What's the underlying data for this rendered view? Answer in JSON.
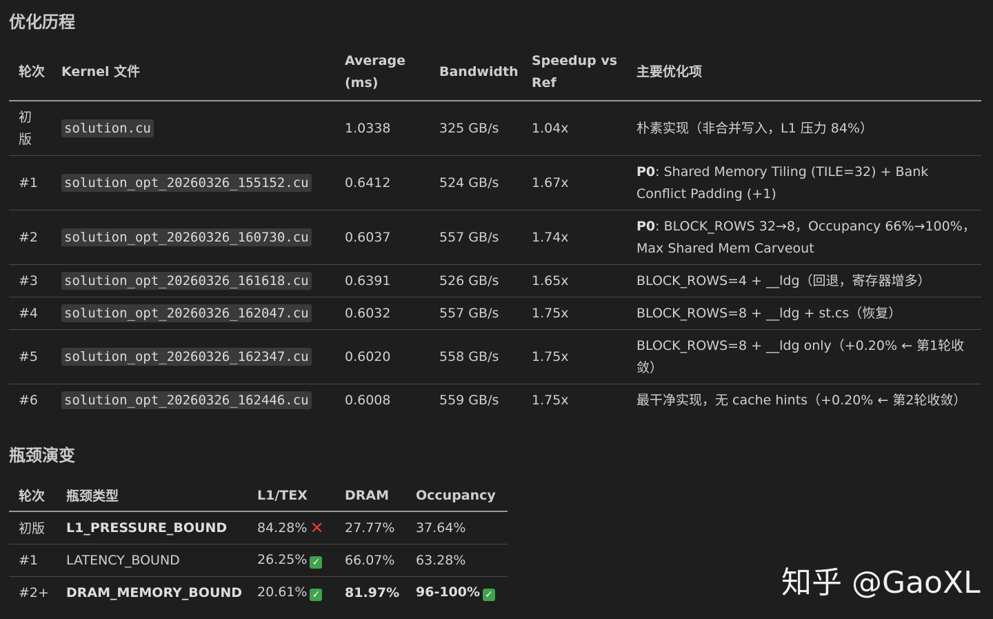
{
  "section1": {
    "title": "优化历程",
    "headers": {
      "round": "轮次",
      "kernel": "Kernel 文件",
      "average": "Average (ms)",
      "bandwidth": "Bandwidth",
      "speedup": "Speedup vs Ref",
      "opt": "主要优化项"
    },
    "rows": [
      {
        "round": "初版",
        "kernel": "solution.cu",
        "average": "1.0338",
        "bandwidth": "325 GB/s",
        "speedup": "1.04x",
        "opt_bold": "",
        "opt": "朴素实现（非合并写入，L1 压力 84%）"
      },
      {
        "round": "#1",
        "kernel": "solution_opt_20260326_155152.cu",
        "average": "0.6412",
        "bandwidth": "524 GB/s",
        "speedup": "1.67x",
        "opt_bold": "P0",
        "opt": ": Shared Memory Tiling (TILE=32) + Bank Conflict Padding (+1)"
      },
      {
        "round": "#2",
        "kernel": "solution_opt_20260326_160730.cu",
        "average": "0.6037",
        "bandwidth": "557 GB/s",
        "speedup": "1.74x",
        "opt_bold": "P0",
        "opt": ": BLOCK_ROWS 32→8，Occupancy 66%→100%，Max Shared Mem Carveout"
      },
      {
        "round": "#3",
        "kernel": "solution_opt_20260326_161618.cu",
        "average": "0.6391",
        "bandwidth": "526 GB/s",
        "speedup": "1.65x",
        "opt_bold": "",
        "opt": "BLOCK_ROWS=4 + __ldg（回退，寄存器增多）"
      },
      {
        "round": "#4",
        "kernel": "solution_opt_20260326_162047.cu",
        "average": "0.6032",
        "bandwidth": "557 GB/s",
        "speedup": "1.75x",
        "opt_bold": "",
        "opt": "BLOCK_ROWS=8 + __ldg + st.cs（恢复）"
      },
      {
        "round": "#5",
        "kernel": "solution_opt_20260326_162347.cu",
        "average": "0.6020",
        "bandwidth": "558 GB/s",
        "speedup": "1.75x",
        "opt_bold": "",
        "opt": "BLOCK_ROWS=8 + __ldg only（+0.20% ← 第1轮收敛）"
      },
      {
        "round": "#6",
        "kernel": "solution_opt_20260326_162446.cu",
        "average": "0.6008",
        "bandwidth": "559 GB/s",
        "speedup": "1.75x",
        "opt_bold": "",
        "opt": "最干净实现，无 cache hints（+0.20% ← 第2轮收敛）"
      }
    ]
  },
  "section2": {
    "title": "瓶颈演变",
    "headers": {
      "round": "轮次",
      "type": "瓶颈类型",
      "l1tex": "L1/TEX",
      "dram": "DRAM",
      "occupancy": "Occupancy"
    },
    "rows": [
      {
        "round": "初版",
        "type": "L1_PRESSURE_BOUND",
        "l1tex": "84.28%",
        "dram": "27.77%",
        "occupancy": "37.64%"
      },
      {
        "round": "#1",
        "type": "LATENCY_BOUND",
        "l1tex": "26.25%",
        "dram": "66.07%",
        "occupancy": "63.28%"
      },
      {
        "round": "#2+",
        "type": "DRAM_MEMORY_BOUND",
        "l1tex": "20.61%",
        "dram": "81.97%",
        "occupancy": "96-100%"
      }
    ]
  },
  "icons": {
    "x": "✕",
    "check": "✓"
  },
  "watermark": "知乎 @GaoXL"
}
